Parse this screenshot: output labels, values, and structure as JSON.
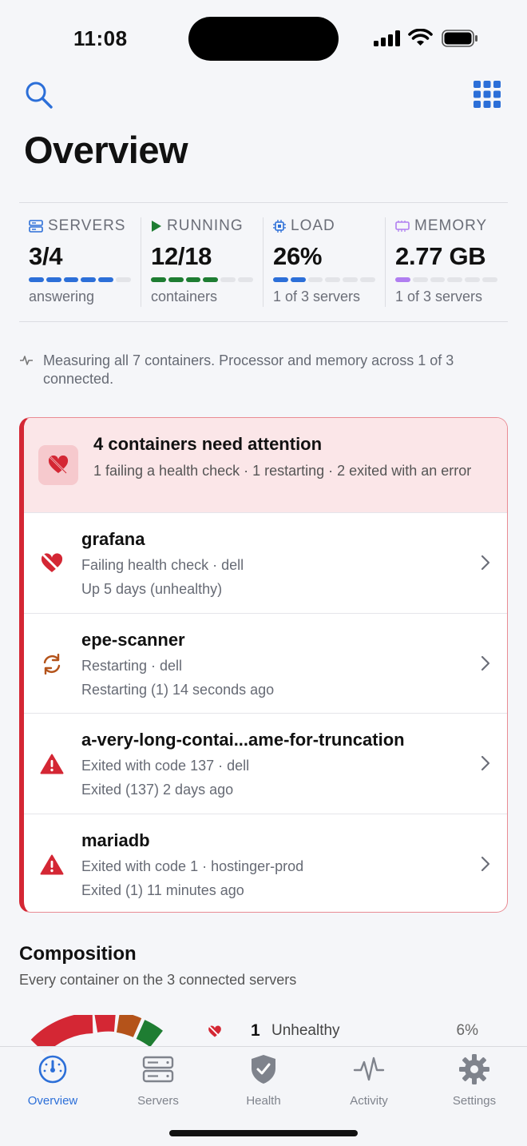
{
  "status": {
    "time": "11:08"
  },
  "header": {
    "title": "Overview"
  },
  "colors": {
    "accent": "#2c6fd8",
    "running": "#1e7d32",
    "memory": "#b07ef0",
    "danger": "#d42734",
    "warning": "#b4531a"
  },
  "stats": [
    {
      "label": "SERVERS",
      "icon": "server-icon",
      "value": "3/4",
      "sub": "answering",
      "fill": 0.75
    },
    {
      "label": "RUNNING",
      "icon": "play-icon",
      "value": "12/18",
      "sub": "containers",
      "fill": 0.6667
    },
    {
      "label": "LOAD",
      "icon": "cpu-icon",
      "value": "26%",
      "sub": "1 of 3 servers",
      "fill": 0.26
    },
    {
      "label": "MEMORY",
      "icon": "memory-icon",
      "value": "2.77 GB",
      "sub": "1 of 3 servers",
      "fill": 0.15
    }
  ],
  "note": "Measuring all 7 containers. Processor and memory across 1 of 3 connected.",
  "attention": {
    "title": "4 containers need attention",
    "subtitle": "1 failing a health check · 1 restarting · 2 exited with an error",
    "items": [
      {
        "name": "grafana",
        "line1": "Failing health check · dell",
        "line2": "Up 5 days (unhealthy)",
        "icon": "broken-heart-icon"
      },
      {
        "name": "epe-scanner",
        "line1": "Restarting · dell",
        "line2": "Restarting (1) 14 seconds ago",
        "icon": "restart-icon"
      },
      {
        "name": "a-very-long-contai...ame-for-truncation",
        "line1": "Exited with code 137 · dell",
        "line2": "Exited (137) 2 days ago",
        "icon": "warning-triangle-icon"
      },
      {
        "name": "mariadb",
        "line1": "Exited with code 1 · hostinger-prod",
        "line2": "Exited (1) 11 minutes ago",
        "icon": "warning-triangle-icon"
      }
    ]
  },
  "composition": {
    "title": "Composition",
    "subtitle": "Every container on the 3 connected servers",
    "legend": [
      {
        "count": "1",
        "label": "Unhealthy",
        "pct": "6%"
      }
    ]
  },
  "tabs": [
    {
      "label": "Overview",
      "icon": "gauge-icon",
      "active": true
    },
    {
      "label": "Servers",
      "icon": "servers-icon",
      "active": false
    },
    {
      "label": "Health",
      "icon": "shield-icon",
      "active": false
    },
    {
      "label": "Activity",
      "icon": "activity-icon",
      "active": false
    },
    {
      "label": "Settings",
      "icon": "gear-icon",
      "active": false
    }
  ]
}
